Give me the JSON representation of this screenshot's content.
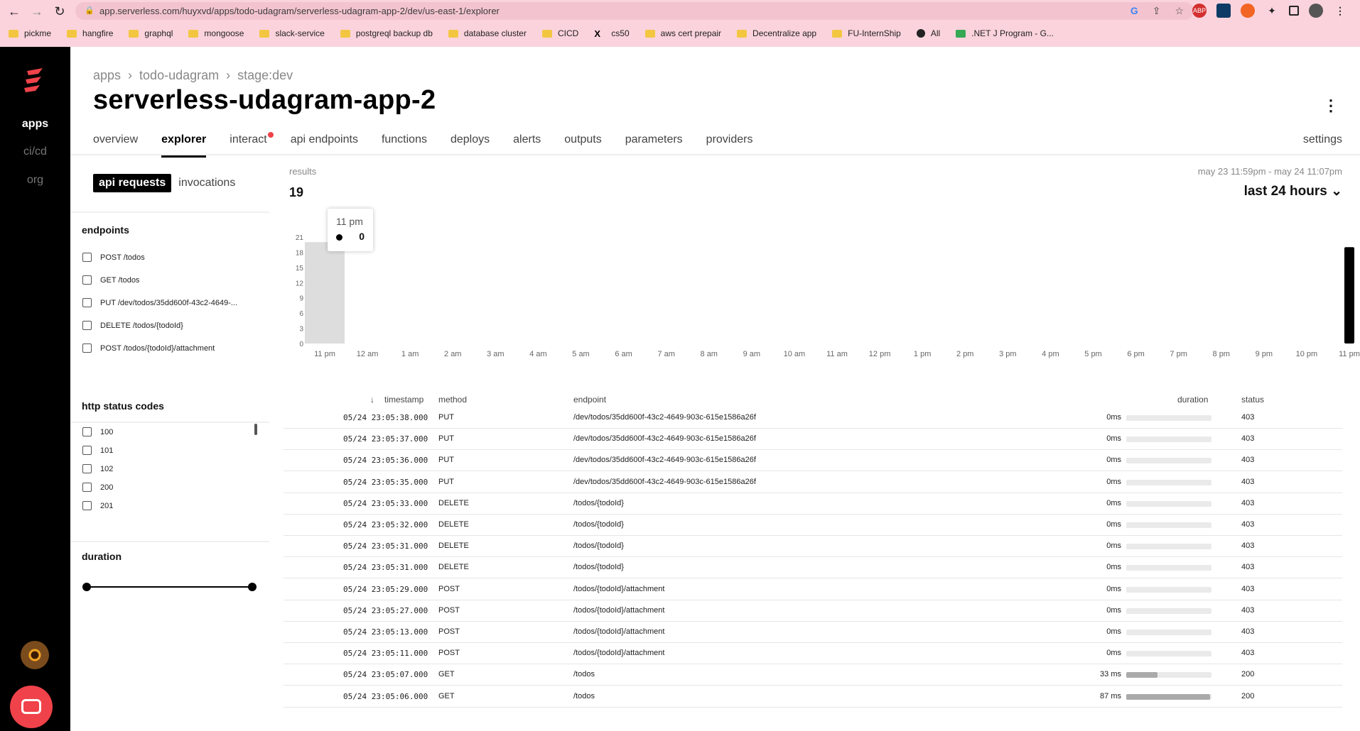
{
  "browser": {
    "url": "app.serverless.com/huyxvd/apps/todo-udagram/serverless-udagram-app-2/dev/us-east-1/explorer",
    "bookmarks": [
      "pickme",
      "hangfire",
      "graphql",
      "mongoose",
      "slack-service",
      "postgreql backup db",
      "database cluster",
      "CICD",
      "cs50",
      "aws cert prepair",
      "Decentralize app",
      "FU-InternShip",
      "All",
      ".NET J Program - G..."
    ],
    "extensions": [
      "ABP"
    ]
  },
  "sidebar": {
    "items": [
      "apps",
      "ci/cd",
      "org"
    ]
  },
  "breadcrumb": [
    "apps",
    "todo-udagram",
    "stage:dev"
  ],
  "title": "serverless-udagram-app-2",
  "tabs": [
    "overview",
    "explorer",
    "interact",
    "api endpoints",
    "functions",
    "deploys",
    "alerts",
    "outputs",
    "parameters",
    "providers"
  ],
  "settings": "settings",
  "segment": {
    "active": "api requests",
    "inactive": "invocations"
  },
  "filters": {
    "endpoints_title": "endpoints",
    "endpoints": [
      "POST /todos",
      "GET /todos",
      "PUT /dev/todos/35dd600f-43c2-4649-...",
      "DELETE /todos/{todoId}",
      "POST /todos/{todoId}/attachment"
    ],
    "status_title": "http status codes",
    "status_codes": [
      "100",
      "101",
      "102",
      "200",
      "201"
    ],
    "duration_title": "duration"
  },
  "results": {
    "label": "results",
    "count": "19"
  },
  "range": {
    "dates": "may 23 11:59pm - may 24 11:07pm",
    "period": "last 24 hours"
  },
  "tooltip": {
    "time": "11 pm",
    "value": "0"
  },
  "chart_data": {
    "type": "bar",
    "categories": [
      "11 pm",
      "12 am",
      "1 am",
      "2 am",
      "3 am",
      "4 am",
      "5 am",
      "6 am",
      "7 am",
      "8 am",
      "9 am",
      "10 am",
      "11 am",
      "12 pm",
      "1 pm",
      "2 pm",
      "3 pm",
      "4 pm",
      "5 pm",
      "6 pm",
      "7 pm",
      "8 pm",
      "9 pm",
      "10 pm",
      "11 pm"
    ],
    "values": [
      0,
      0,
      0,
      0,
      0,
      0,
      0,
      0,
      0,
      0,
      0,
      0,
      0,
      0,
      0,
      0,
      0,
      0,
      0,
      0,
      0,
      0,
      0,
      0,
      19
    ],
    "highlight": {
      "index": 0,
      "value": 20
    },
    "yticks": [
      0,
      3,
      6,
      9,
      12,
      15,
      18,
      21
    ],
    "ylim": [
      0,
      21
    ]
  },
  "table": {
    "headers": [
      "timestamp",
      "method",
      "endpoint",
      "duration",
      "status"
    ],
    "rows": [
      {
        "ts": "05/24 23:05:38.000",
        "method": "PUT",
        "endpoint": "/dev/todos/35dd600f-43c2-4649-903c-615e1586a26f",
        "duration": "0ms",
        "status": "403",
        "pct": 0
      },
      {
        "ts": "05/24 23:05:37.000",
        "method": "PUT",
        "endpoint": "/dev/todos/35dd600f-43c2-4649-903c-615e1586a26f",
        "duration": "0ms",
        "status": "403",
        "pct": 0
      },
      {
        "ts": "05/24 23:05:36.000",
        "method": "PUT",
        "endpoint": "/dev/todos/35dd600f-43c2-4649-903c-615e1586a26f",
        "duration": "0ms",
        "status": "403",
        "pct": 0
      },
      {
        "ts": "05/24 23:05:35.000",
        "method": "PUT",
        "endpoint": "/dev/todos/35dd600f-43c2-4649-903c-615e1586a26f",
        "duration": "0ms",
        "status": "403",
        "pct": 0
      },
      {
        "ts": "05/24 23:05:33.000",
        "method": "DELETE",
        "endpoint": "/todos/{todoId}",
        "duration": "0ms",
        "status": "403",
        "pct": 0
      },
      {
        "ts": "05/24 23:05:32.000",
        "method": "DELETE",
        "endpoint": "/todos/{todoId}",
        "duration": "0ms",
        "status": "403",
        "pct": 0
      },
      {
        "ts": "05/24 23:05:31.000",
        "method": "DELETE",
        "endpoint": "/todos/{todoId}",
        "duration": "0ms",
        "status": "403",
        "pct": 0
      },
      {
        "ts": "05/24 23:05:31.000",
        "method": "DELETE",
        "endpoint": "/todos/{todoId}",
        "duration": "0ms",
        "status": "403",
        "pct": 0
      },
      {
        "ts": "05/24 23:05:29.000",
        "method": "POST",
        "endpoint": "/todos/{todoId}/attachment",
        "duration": "0ms",
        "status": "403",
        "pct": 0
      },
      {
        "ts": "05/24 23:05:27.000",
        "method": "POST",
        "endpoint": "/todos/{todoId}/attachment",
        "duration": "0ms",
        "status": "403",
        "pct": 0
      },
      {
        "ts": "05/24 23:05:13.000",
        "method": "POST",
        "endpoint": "/todos/{todoId}/attachment",
        "duration": "0ms",
        "status": "403",
        "pct": 0
      },
      {
        "ts": "05/24 23:05:11.000",
        "method": "POST",
        "endpoint": "/todos/{todoId}/attachment",
        "duration": "0ms",
        "status": "403",
        "pct": 0
      },
      {
        "ts": "05/24 23:05:07.000",
        "method": "GET",
        "endpoint": "/todos",
        "duration": "33 ms",
        "status": "200",
        "pct": 0.37
      },
      {
        "ts": "05/24 23:05:06.000",
        "method": "GET",
        "endpoint": "/todos",
        "duration": "87 ms",
        "status": "200",
        "pct": 0.98
      }
    ]
  }
}
